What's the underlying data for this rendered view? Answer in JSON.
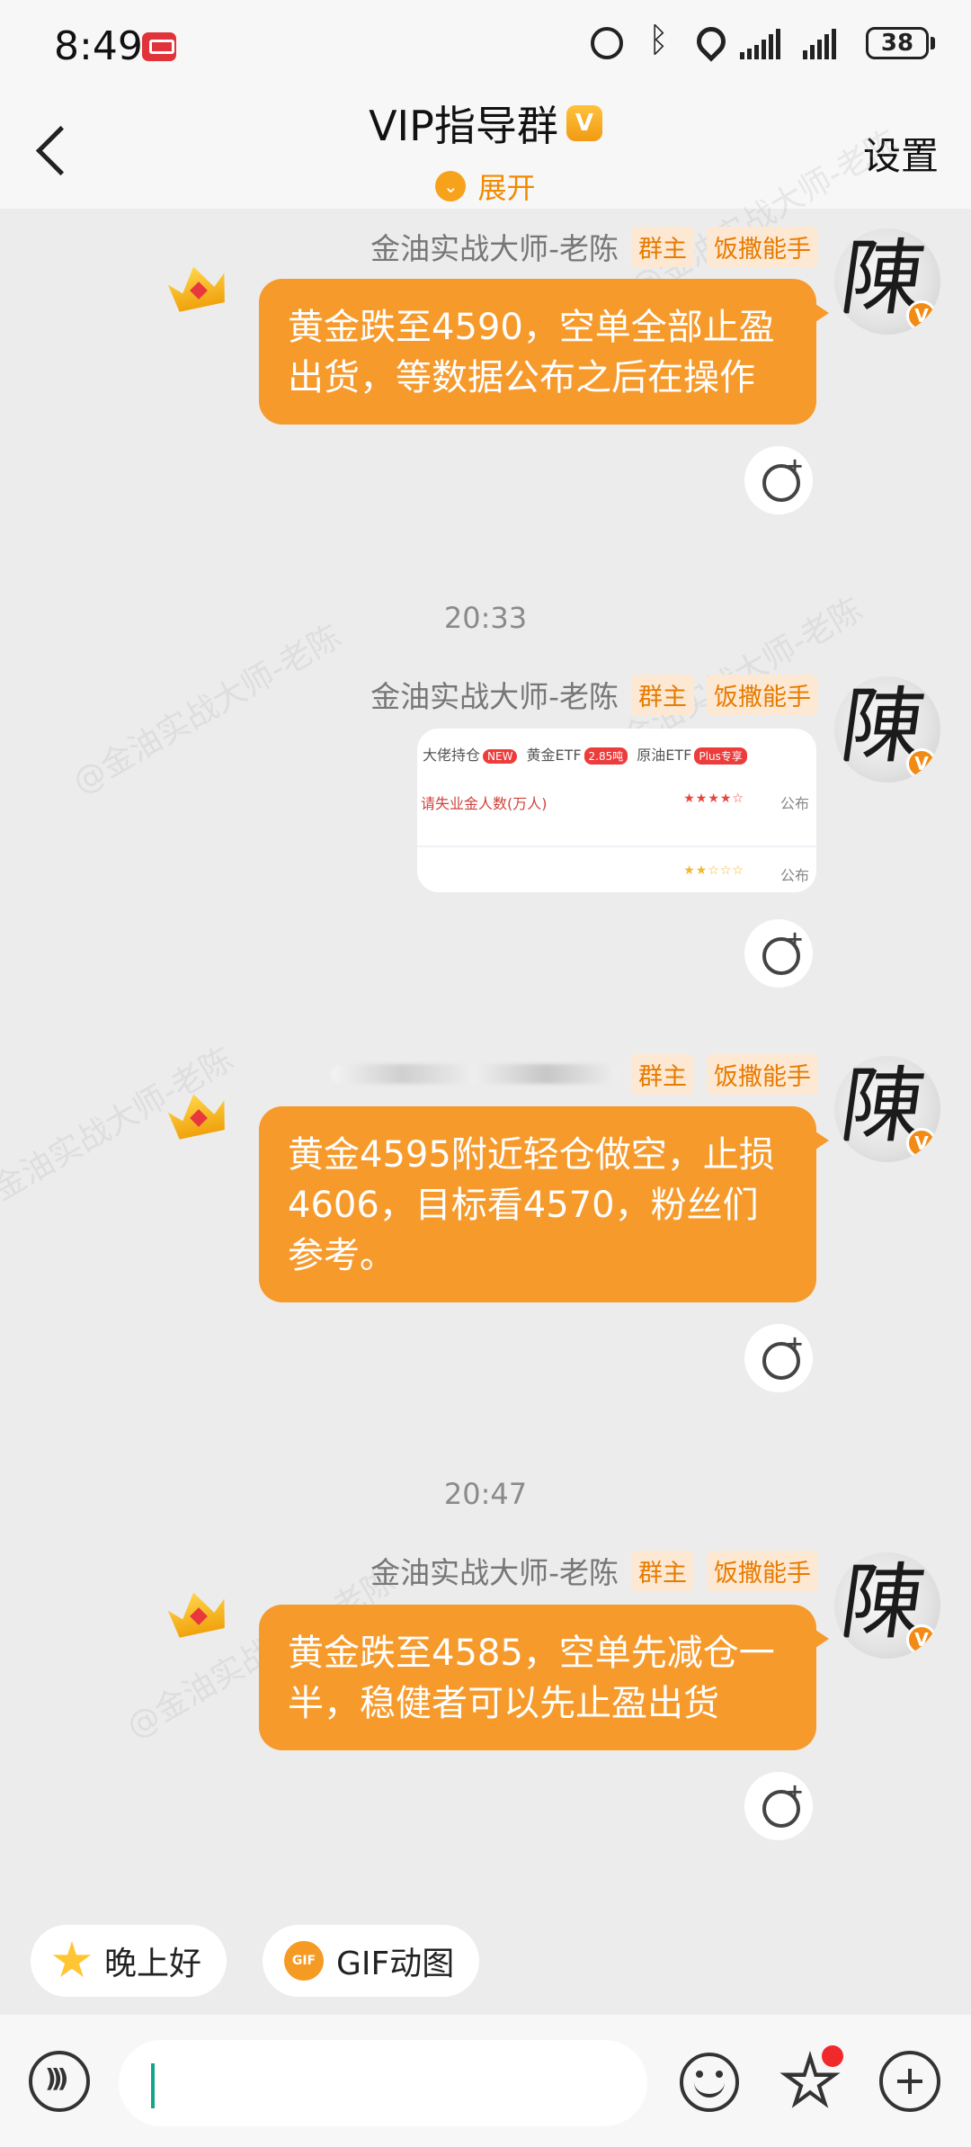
{
  "status_bar": {
    "time": "8:49",
    "battery": "38",
    "icons": [
      "alarm-icon",
      "bluetooth-icon",
      "location-icon",
      "signal-icon",
      "signal-icon",
      "battery-icon"
    ]
  },
  "header": {
    "back_icon": "chevron-left-icon",
    "title": "VIP指导群",
    "title_badge": "V",
    "expand_label": "展开",
    "settings_label": "设置"
  },
  "messages": [
    {
      "sender": "金油实战大师-老陈",
      "tags": [
        "群主",
        "饭撒能手"
      ],
      "text": "黄金跌至4590，空单全部止盈出货，等数据公布之后在操作"
    },
    {
      "time": "20:33"
    },
    {
      "sender": "金油实战大师-老陈",
      "tags": [
        "群主",
        "饭撒能手"
      ],
      "image": {
        "tabs": [
          "大佬持仓",
          "黄金ETF",
          "原油ETF"
        ],
        "tab_badges": [
          "NEW",
          "2.85吨",
          "Plus专享"
        ],
        "row_label": "请失业金人数(万人)",
        "row_stars": "★★★★☆",
        "row_suffix": "公布",
        "row2_stars": "★★☆☆☆",
        "row2_suffix": "公布"
      }
    },
    {
      "sender_blurred": true,
      "tags": [
        "群主",
        "饭撒能手"
      ],
      "text": "黄金4595附近轻仓做空，止损4606，目标看4570，粉丝们参考。"
    },
    {
      "time": "20:47"
    },
    {
      "sender": "金油实战大师-老陈",
      "tags": [
        "群主",
        "饭撒能手"
      ],
      "text": "黄金跌至4585，空单先减仓一半，稳健者可以先止盈出货"
    }
  ],
  "avatar": {
    "glyph": "陳",
    "badge": "V"
  },
  "watermark": "@金油实战大师-老陈",
  "quick_replies": [
    {
      "icon": "star-emoji-icon",
      "label": "晚上好"
    },
    {
      "icon": "gif-icon",
      "icon_text": "GIF",
      "label": "GIF动图"
    }
  ],
  "input_bar": {
    "icons": [
      "voice-icon",
      "emoji-icon",
      "sticker-icon",
      "plus-icon"
    ]
  },
  "colors": {
    "bubble": "#f79a2c",
    "tag_bg": "#fde9d3",
    "tag_text": "#e87a00",
    "background": "#ececec"
  }
}
